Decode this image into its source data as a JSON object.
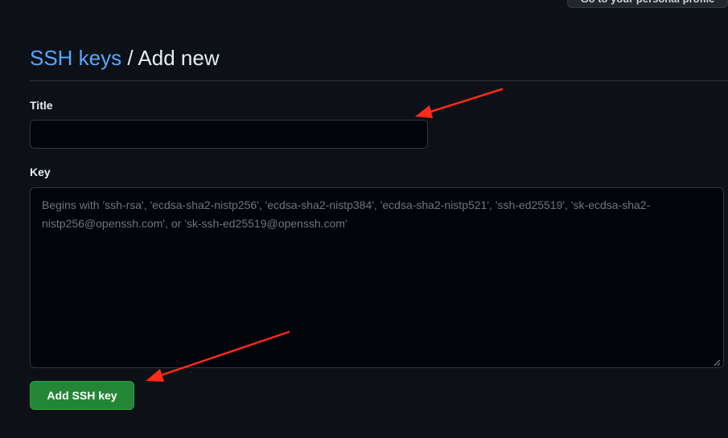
{
  "header": {
    "profile_button_label": "Go to your personal profile"
  },
  "breadcrumb": {
    "parent_link": "SSH keys",
    "separator": "/",
    "current": "Add new"
  },
  "form": {
    "title_label": "Title",
    "title_value": "",
    "key_label": "Key",
    "key_value": "",
    "key_placeholder": "Begins with 'ssh-rsa', 'ecdsa-sha2-nistp256', 'ecdsa-sha2-nistp384', 'ecdsa-sha2-nistp521', 'ssh-ed25519', 'sk-ecdsa-sha2-nistp256@openssh.com', or 'sk-ssh-ed25519@openssh.com'",
    "submit_label": "Add SSH key"
  },
  "colors": {
    "background": "#0d1117",
    "link": "#58a6ff",
    "primary_button": "#238636",
    "annotation_arrow": "#ff2a1a"
  }
}
